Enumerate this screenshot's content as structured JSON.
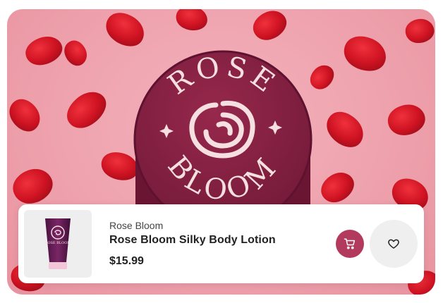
{
  "hero": {
    "logo_top": "ROSE",
    "logo_bottom": "BLOOM",
    "colors": {
      "background": "#ef9fab",
      "jar_lid": "#8a2244",
      "petal": "#d11a2a",
      "logo": "#f6dfe0"
    }
  },
  "product": {
    "brand": "Rose Bloom",
    "name": "Rose Bloom Silky Body Lotion",
    "price": "$15.99",
    "thumbnail_logo": "ROSE BLOOM"
  },
  "actions": {
    "cart_icon": "shopping-cart-icon",
    "wishlist_icon": "heart-icon",
    "accent": "#b23a5c"
  }
}
